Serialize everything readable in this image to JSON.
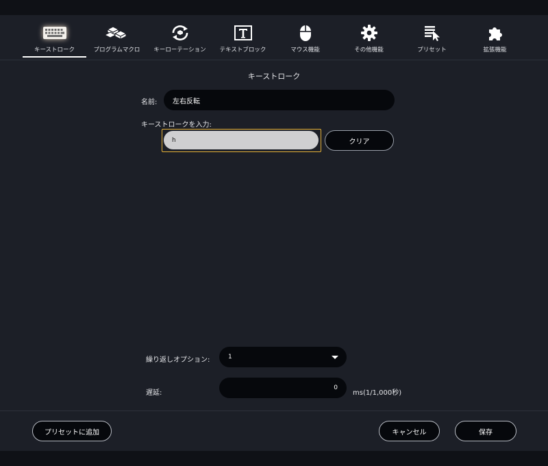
{
  "tabs": [
    {
      "label": "キーストローク",
      "icon": "keyboard-icon",
      "active": true
    },
    {
      "label": "プログラムマクロ",
      "icon": "keys-stack-icon",
      "active": false
    },
    {
      "label": "キーローテーション",
      "icon": "rotation-icon",
      "active": false
    },
    {
      "label": "テキストブロック",
      "icon": "text-block-icon",
      "active": false
    },
    {
      "label": "マウス機能",
      "icon": "mouse-icon",
      "active": false
    },
    {
      "label": "その他機能",
      "icon": "gear-icon",
      "active": false
    },
    {
      "label": "プリセット",
      "icon": "preset-list-icon",
      "active": false
    },
    {
      "label": "拡張機能",
      "icon": "puzzle-icon",
      "active": false
    }
  ],
  "section_title": "キーストローク",
  "form": {
    "name_label": "名前:",
    "name_value": "左右反転",
    "keystroke_label": "キーストロークを入力:",
    "keystroke_value": "h",
    "clear_label": "クリア",
    "repeat_label": "繰り返しオプション:",
    "repeat_value": "1",
    "delay_label": "遅延:",
    "delay_value": "0",
    "delay_unit": "ms(1/1,000秒)"
  },
  "footer": {
    "add_preset_label": "プリセットに追加",
    "cancel_label": "キャンセル",
    "save_label": "保存"
  },
  "colors": {
    "background": "#1c1f27",
    "field": "#06080c",
    "focus_border": "#e7b238"
  }
}
